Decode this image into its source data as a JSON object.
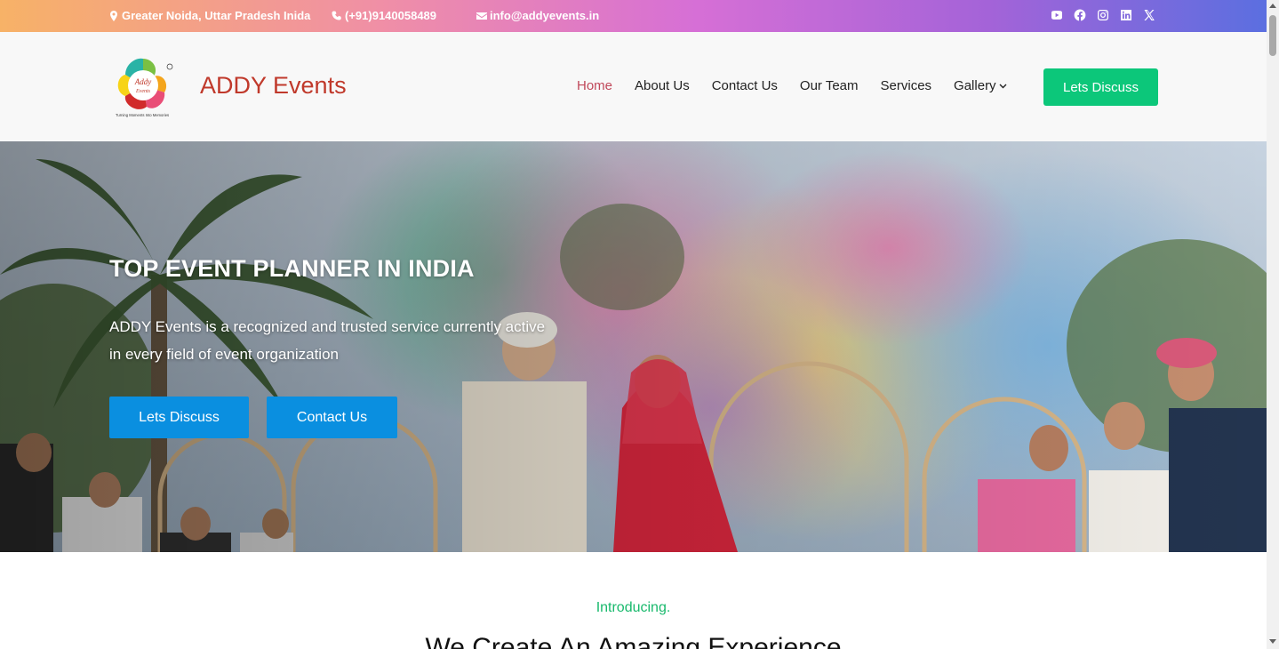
{
  "topbar": {
    "location": "Greater Noida, Uttar Pradesh Inida",
    "phone": "(+91)9140058489",
    "email": "info@addyevents.in",
    "social": [
      "youtube-icon",
      "facebook-icon",
      "instagram-icon",
      "linkedin-icon",
      "x-icon"
    ]
  },
  "header": {
    "brand": "ADDY Events",
    "logo_text": "Addy Events",
    "logo_tagline": "Turning Moments Into Memories",
    "nav": [
      {
        "label": "Home",
        "active": true
      },
      {
        "label": "About Us"
      },
      {
        "label": "Contact Us"
      },
      {
        "label": "Our Team"
      },
      {
        "label": "Services"
      },
      {
        "label": "Gallery",
        "dropdown": true
      }
    ],
    "cta": "Lets Discuss"
  },
  "hero": {
    "title": "TOP EVENT PLANNER IN INDIA",
    "text": "ADDY Events is a recognized and trusted service currently active in every field of event organization",
    "button_primary": "Lets Discuss",
    "button_secondary": "Contact Us"
  },
  "intro": {
    "kicker": "Introducing.",
    "heading": "We Create An Amazing Experience"
  },
  "colors": {
    "accent_green": "#0cc77a",
    "hero_button_blue": "#0a8fe0",
    "brand_red": "#c0392b",
    "nav_active": "#c0485a"
  }
}
